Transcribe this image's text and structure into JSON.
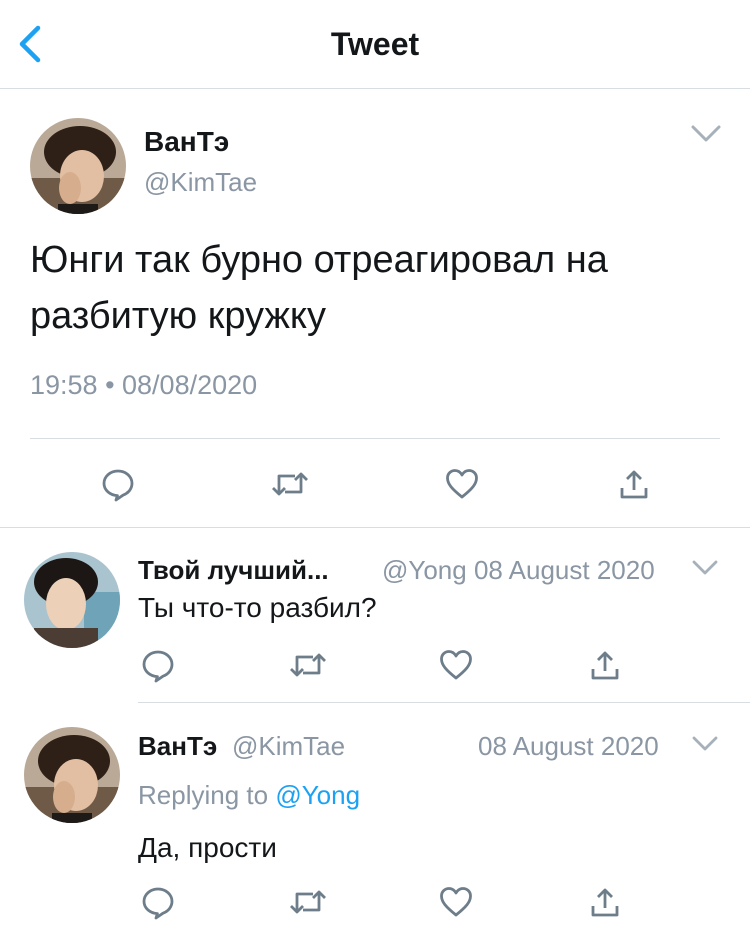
{
  "header": {
    "title": "Tweet",
    "back_icon": "chevron-left-icon"
  },
  "main_tweet": {
    "author_name": "ВанТэ",
    "author_handle": "@KimTae",
    "text": "Юнги так бурно отреагировал на разбитую кружку",
    "timestamp": "19:58 • 08/08/2020"
  },
  "replies": [
    {
      "author_name": "Твой лучший...",
      "handle_date": "@Yong 08 August 2020",
      "text": "Ты что-то разбил?"
    },
    {
      "author_name": "ВанТэ",
      "author_handle": "@KimTae",
      "date": "08 August 2020",
      "replying_label": "Replying to",
      "replying_handle": "@Yong",
      "text": "Да, прости"
    }
  ],
  "colors": {
    "accent": "#1da1f2",
    "muted": "#8a96a3",
    "icon": "#6e7d8a",
    "divider": "#d8dde1"
  },
  "icons": [
    "chevron-left-icon",
    "chevron-down-icon",
    "reply-icon",
    "retweet-icon",
    "like-icon",
    "share-icon"
  ]
}
